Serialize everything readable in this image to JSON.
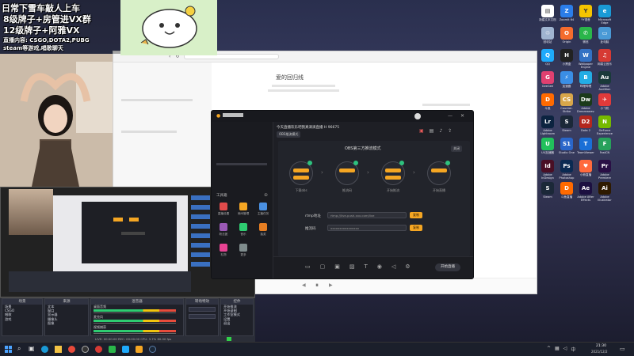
{
  "stream_overlay": {
    "line1": "日常下雪车敲人上车",
    "line2": "8级牌子+房管进VX群",
    "line3": "12级牌子+阿雅VX",
    "line4": "直播内容: CSGO,DOTA2,PUBG",
    "line5": "steam等游戏,唱歌聊天"
  },
  "desktop": {
    "icons": [
      {
        "label": "新建文本文档",
        "icon": "doc-icon",
        "color": "#ffffff",
        "glyph": "▤"
      },
      {
        "label": "ZoomIt 64",
        "icon": "zoomit-icon",
        "color": "#2b7de9",
        "glyph": "Z"
      },
      {
        "label": "YY语音",
        "icon": "yy-icon",
        "color": "#f5c400",
        "glyph": "Y"
      },
      {
        "label": "Microsoft Edge",
        "icon": "edge-icon",
        "color": "#1a9ad6",
        "glyph": "e"
      },
      {
        "label": "回收站",
        "icon": "recycle-icon",
        "color": "#9fb4d0",
        "glyph": "♲"
      },
      {
        "label": "Origin",
        "icon": "origin-icon",
        "color": "#f56c2d",
        "glyph": "O"
      },
      {
        "label": "微信",
        "icon": "wechat-icon",
        "color": "#2ab64a",
        "glyph": "✆"
      },
      {
        "label": "此电脑",
        "icon": "pc-icon",
        "color": "#4a9ad6",
        "glyph": "▭"
      },
      {
        "label": "QQ",
        "icon": "qq-icon",
        "color": "#1eaafc",
        "glyph": "Q"
      },
      {
        "label": "小黑盒",
        "icon": "heybox-icon",
        "color": "#222222",
        "glyph": "H"
      },
      {
        "label": "Wallpaper Engine",
        "icon": "wallpaper-icon",
        "color": "#3472c4",
        "glyph": "W"
      },
      {
        "label": "网易云音乐",
        "icon": "music-icon",
        "color": "#d63a34",
        "glyph": "♫"
      },
      {
        "label": "GeeGee",
        "icon": "geegee-icon",
        "color": "#e04070",
        "glyph": "G"
      },
      {
        "label": "加速器",
        "icon": "accel-icon",
        "color": "#3a8ee6",
        "glyph": "⚡"
      },
      {
        "label": "哔哩哔哩",
        "icon": "bilibili-icon",
        "color": "#23ade5",
        "glyph": "B"
      },
      {
        "label": "Adobe Audition",
        "icon": "audition-icon",
        "color": "#1a3a3a",
        "glyph": "Au"
      },
      {
        "label": "斗鱼",
        "icon": "douyu-icon",
        "color": "#ff6a00",
        "glyph": "D"
      },
      {
        "label": "Counter-Strike",
        "icon": "cs-icon",
        "color": "#d7a64a",
        "glyph": "CS"
      },
      {
        "label": "Adobe Dreamweaver",
        "icon": "dreamweaver-icon",
        "color": "#1b3a1a",
        "glyph": "Dw"
      },
      {
        "label": "小飞机",
        "icon": "plane-icon",
        "color": "#e03a3a",
        "glyph": "✈"
      },
      {
        "label": "Adobe Lightroom",
        "icon": "lightroom-icon",
        "color": "#0c2340",
        "glyph": "Lr"
      },
      {
        "label": "Steam",
        "icon": "steam-icon",
        "color": "#1b2838",
        "glyph": "S"
      },
      {
        "label": "Dota 2",
        "icon": "dota-icon",
        "color": "#b3261e",
        "glyph": "D2"
      },
      {
        "label": "GeForce Experience",
        "icon": "nvidia-icon",
        "color": "#76b900",
        "glyph": "N"
      },
      {
        "label": "UU加速器",
        "icon": "uu-icon",
        "color": "#21c05b",
        "glyph": "U"
      },
      {
        "label": "Studio One",
        "icon": "studio-icon",
        "color": "#2a66c9",
        "glyph": "S1"
      },
      {
        "label": "TeamViewer",
        "icon": "teamviewer-icon",
        "color": "#1a6fd6",
        "glyph": "T"
      },
      {
        "label": "FastCN",
        "icon": "fastcn-icon",
        "color": "#27a15b",
        "glyph": "F"
      },
      {
        "label": "Adobe InDesign",
        "icon": "indesign-icon",
        "color": "#4a0f25",
        "glyph": "Id"
      },
      {
        "label": "Adobe Photoshop",
        "icon": "photoshop-icon",
        "color": "#0a2a52",
        "glyph": "Ps"
      },
      {
        "label": "小熊直播",
        "icon": "bear-icon",
        "color": "#ff6a3d",
        "glyph": "♥"
      },
      {
        "label": "Adobe Premiere",
        "icon": "premiere-icon",
        "color": "#2a0f45",
        "glyph": "Pr"
      },
      {
        "label": "Steam",
        "icon": "steam2-icon",
        "color": "#1b2838",
        "glyph": "S"
      },
      {
        "label": "斗鱼直播",
        "icon": "douyu2-icon",
        "color": "#ff6a00",
        "glyph": "D"
      },
      {
        "label": "Adobe After Effects",
        "icon": "aftereffects-icon",
        "color": "#1c1040",
        "glyph": "Ae"
      },
      {
        "label": "Adobe Illustrator",
        "icon": "illustrator-icon",
        "color": "#2e1a00",
        "glyph": "Ai"
      }
    ]
  },
  "browser": {
    "title": "爱的回归线"
  },
  "stream_app": {
    "room_title": "今天直播欢乐吧我真滴滴直播 H 96675",
    "obs_mode_label": "OBS推流模式",
    "center_heading": "OBS第三方推流模式",
    "close_label": "关闭",
    "steps": [
      "下载obs",
      "推流码",
      "开始推流",
      "开始直播"
    ],
    "field1_label": "rtmp地址",
    "field1_value": "rtmp://live-push.xxx.com/live",
    "field2_label": "推流码",
    "field2_value": "xxxxxxxxxxxxxxxx",
    "copy_label": "复制",
    "tool_label": "工具箱",
    "tools": [
      "直播设置",
      "房间管理",
      "主播任务",
      "粉丝团",
      "音乐",
      "抽奖",
      "礼物",
      "更多"
    ],
    "start_button": "开始直播"
  },
  "obs": {
    "panels": {
      "scenes": "场景",
      "sources": "来源",
      "mixer": "混音器",
      "transitions": "转场特效",
      "controls": "控件"
    },
    "scene_items": [
      "场景",
      "CSGO",
      "唱歌",
      "游戏"
    ],
    "source_items": [
      "文本",
      "窗口",
      "显示器",
      "摄像头",
      "图像"
    ],
    "mixer_items": [
      "桌面音频",
      "麦克风",
      "视频捕获"
    ],
    "control_items": [
      "开始推流",
      "开始录制",
      "工作室模式",
      "设置",
      "退出"
    ],
    "status": "LIVE: 00:00:00  REC: 00:00:00  CPU: 3.7%  60.00 fps"
  },
  "taskbar": {
    "time": "21:30",
    "date": "2021/12/2"
  }
}
